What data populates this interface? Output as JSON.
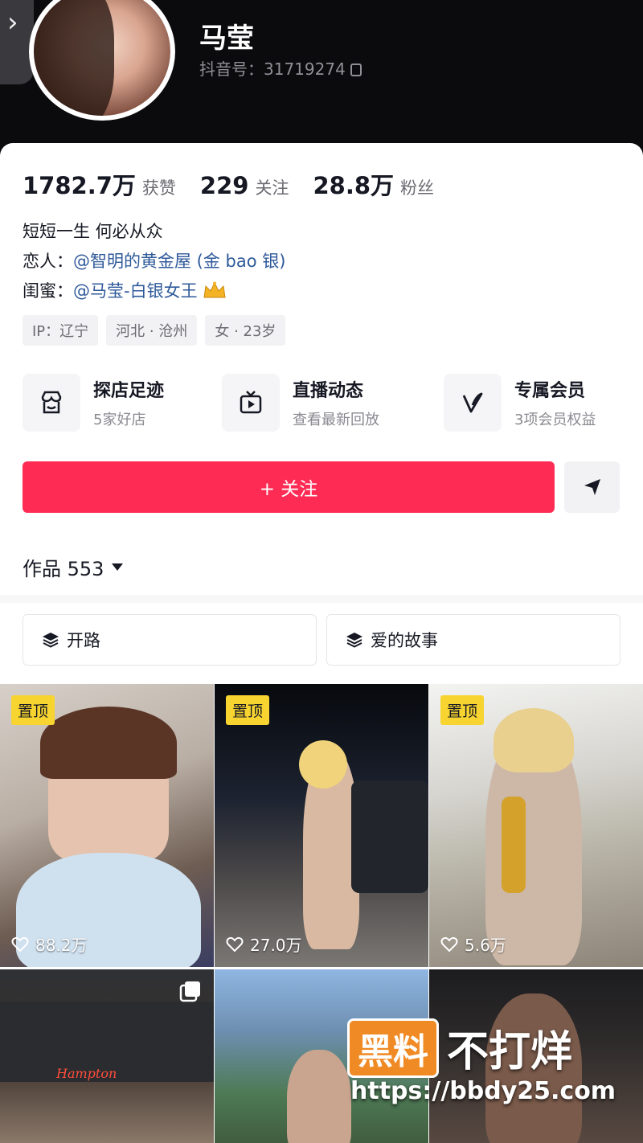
{
  "profile": {
    "name": "马莹",
    "douyin_id_label": "抖音号：31719274",
    "back_icon": "chevron-right-icon"
  },
  "stats": [
    {
      "num": "1782.7万",
      "label": "获赞"
    },
    {
      "num": "229",
      "label": "关注"
    },
    {
      "num": "28.8万",
      "label": "粉丝"
    }
  ],
  "bio": {
    "line1": "短短一生 何必从众",
    "line2_prefix": "恋人：",
    "line2_mention": "@智明的黄金屋 (金 bao 银)",
    "line3_prefix": "闺蜜：",
    "line3_mention": "@马莹-白银女王"
  },
  "tags": [
    "IP：辽宁",
    "河北 · 沧州",
    "女 · 23岁"
  ],
  "features": [
    {
      "title": "探店足迹",
      "sub": "5家好店",
      "icon": "store-icon"
    },
    {
      "title": "直播动态",
      "sub": "查看最新回放",
      "icon": "tv-icon"
    },
    {
      "title": "专属会员",
      "sub": "3项会员权益",
      "icon": "vip-icon"
    }
  ],
  "follow_button": "+ 关注",
  "works_label": "作品 553",
  "collections": [
    "开路",
    "爱的故事"
  ],
  "pin_label": "置顶",
  "videos": [
    {
      "likes": "88.2万",
      "pinned": true
    },
    {
      "likes": "27.0万",
      "pinned": true
    },
    {
      "likes": "5.6万",
      "pinned": true
    },
    {
      "likes": "",
      "pinned": false,
      "sign": "Hampton"
    },
    {
      "likes": "",
      "pinned": false
    },
    {
      "likes": "",
      "pinned": false
    }
  ],
  "watermark": {
    "badge": "黑料",
    "text": "不打烊",
    "url": "https://bbdy25.com"
  },
  "colors": {
    "accent": "#fe2c55",
    "pin": "#f7d430",
    "mention": "#2f5a9a",
    "watermark_badge": "#f08a24"
  }
}
